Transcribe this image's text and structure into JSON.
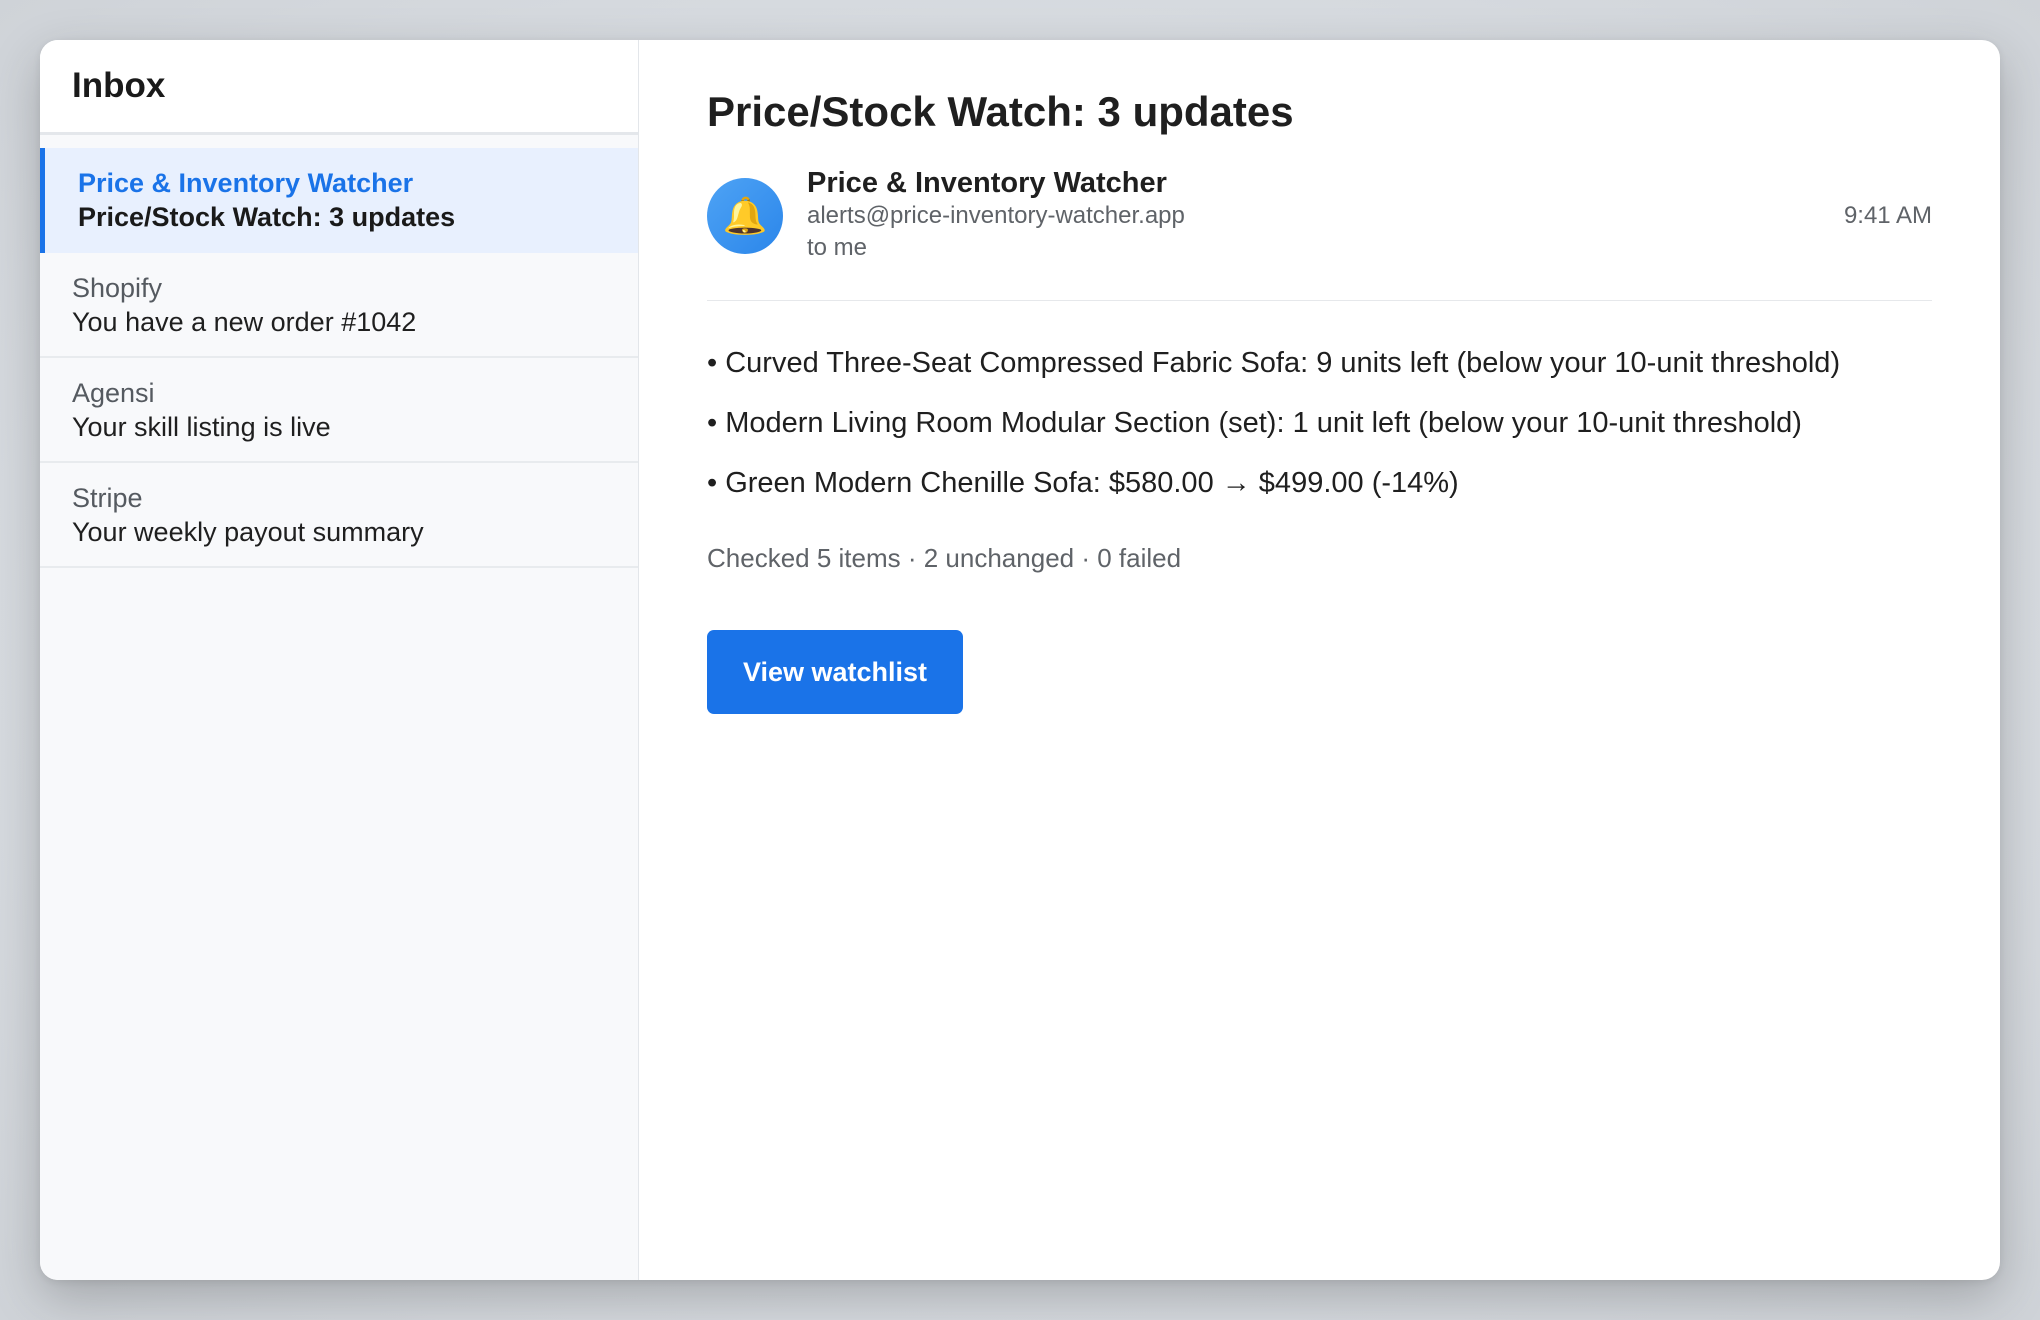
{
  "sidebar": {
    "title": "Inbox",
    "items": [
      {
        "sender": "Price & Inventory Watcher",
        "subject": "Price/Stock Watch: 3 updates",
        "selected": true
      },
      {
        "sender": "Shopify",
        "subject": "You have a new order #1042"
      },
      {
        "sender": "Agensi",
        "subject": "Your skill listing is live"
      },
      {
        "sender": "Stripe",
        "subject": "Your weekly payout summary"
      }
    ]
  },
  "email": {
    "title": "Price/Stock Watch: 3 updates",
    "avatar_icon": "bell-icon",
    "sender_name": "Price & Inventory Watcher",
    "sender_email": "alerts@price-inventory-watcher.app",
    "recipient": "to me",
    "time": "9:41 AM",
    "body_lines": [
      "• Curved Three-Seat Compressed Fabric Sofa: 9 units left (below your 10-unit threshold)",
      "• Modern Living Room Modular Section (set): 1 unit left (below your 10-unit threshold)",
      "• Green Modern Chenille Sofa: $580.00 → $499.00 (-14%)"
    ],
    "summary": "Checked 5 items · 2 unchanged · 0 failed",
    "button_label": "View watchlist"
  },
  "colors": {
    "accent": "#1a73e8",
    "selected_bg": "#e8f0fe"
  }
}
